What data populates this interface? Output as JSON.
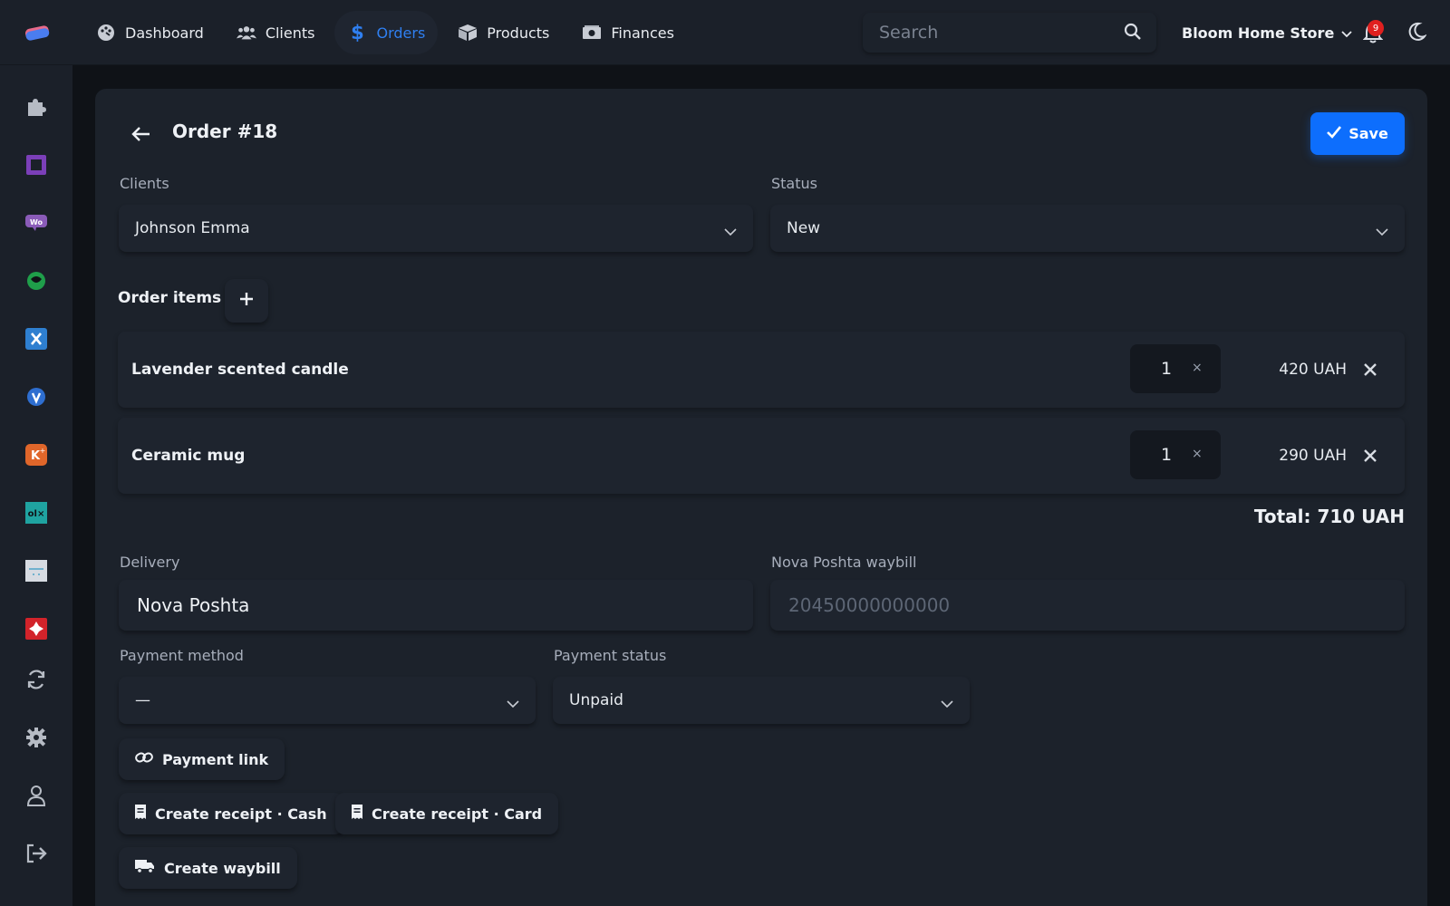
{
  "nav": {
    "items": [
      {
        "label": "Dashboard",
        "icon": "palette-icon"
      },
      {
        "label": "Clients",
        "icon": "users-icon"
      },
      {
        "label": "Orders",
        "icon": "dollar-icon",
        "active": true
      },
      {
        "label": "Products",
        "icon": "box-icon"
      },
      {
        "label": "Finances",
        "icon": "money-icon"
      }
    ],
    "active_color": "#2f7ff0"
  },
  "search": {
    "placeholder": "Search"
  },
  "store": {
    "name": "Bloom Home Store"
  },
  "notifications": {
    "count": "9"
  },
  "sidebar": {
    "items": [
      "puzzle-icon",
      "square-app-icon",
      "woo-icon",
      "green-app-icon",
      "x-app-icon",
      "shield-app-icon",
      "k-app-icon",
      "olx-icon",
      "image-app-icon",
      "red-app-icon",
      "sync-icon",
      "gear-icon",
      "user-icon",
      "logout-icon"
    ]
  },
  "order": {
    "title": "Order #18",
    "save_label": "Save",
    "clients_label": "Clients",
    "client_value": "Johnson Emma",
    "status_label": "Status",
    "status_value": "New",
    "items_title": "Order items",
    "items": [
      {
        "name": "Lavender scented candle",
        "qty": "1",
        "x": "×",
        "price": "420 UAH"
      },
      {
        "name": "Ceramic mug",
        "qty": "1",
        "x": "×",
        "price": "290 UAH"
      }
    ],
    "total": "Total: 710 UAH",
    "delivery_label": "Delivery",
    "delivery_value": "Nova Poshta",
    "waybill_label": "Nova Poshta waybill",
    "waybill_placeholder": "20450000000000",
    "payment_method_label": "Payment method",
    "payment_method_value": "—",
    "payment_status_label": "Payment status",
    "payment_status_value": "Unpaid",
    "payment_link_label": "Payment link",
    "receipt_cash_label": "Create receipt · Cash",
    "receipt_card_label": "Create receipt · Card",
    "waybill_btn_label": "Create waybill"
  },
  "colors": {
    "accent": "#0d6efd",
    "badge": "#e0201f"
  }
}
